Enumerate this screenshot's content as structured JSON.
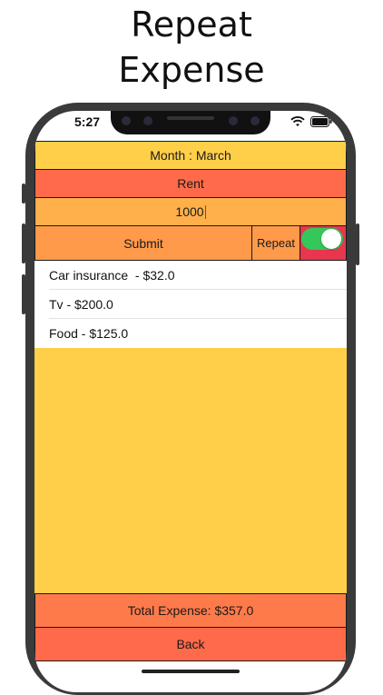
{
  "promo": {
    "title_line1": "Repeat",
    "title_line2": "Expense"
  },
  "status_bar": {
    "time": "5:27",
    "icons": [
      "signal-icon",
      "wifi-icon",
      "battery-icon"
    ]
  },
  "form": {
    "month_label": "Month : March",
    "category": "Rent",
    "amount": "1000",
    "submit_label": "Submit",
    "repeat_label": "Repeat",
    "repeat_toggle_on": true
  },
  "expenses": [
    {
      "label": "Car insurance  - $32.0"
    },
    {
      "label": "Tv - $200.0"
    },
    {
      "label": "Food - $125.0"
    }
  ],
  "footer": {
    "total_label": "Total Expense: $357.0",
    "back_label": "Back"
  },
  "colors": {
    "month_bg": "#FFCF4A",
    "category_bg": "#FF6B4A",
    "amount_bg": "#FFB04A",
    "submit_bg": "#FF9A4A",
    "toggle_cell_bg": "#E8364F",
    "toggle_on": "#34C759",
    "total_bg": "#FF7A4A",
    "back_bg": "#FF6B4A"
  }
}
